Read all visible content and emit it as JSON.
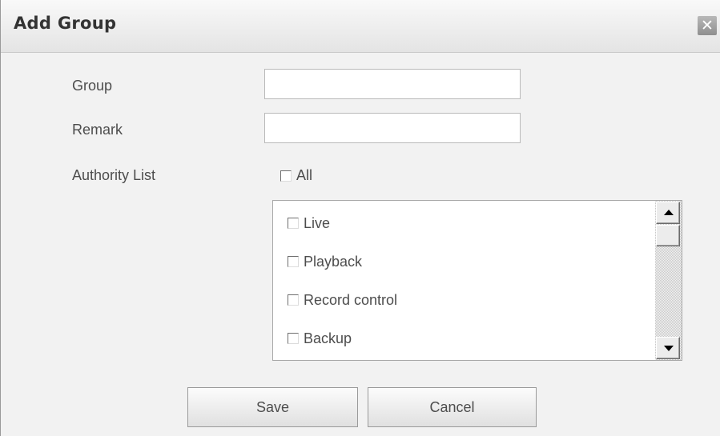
{
  "dialog": {
    "title": "Add Group",
    "close_icon": "close-icon"
  },
  "form": {
    "group_label": "Group",
    "group_value": "",
    "remark_label": "Remark",
    "remark_value": "",
    "authority_label": "Authority List",
    "all_label": "All",
    "all_checked": false
  },
  "authority_list": {
    "items": [
      {
        "label": "Live",
        "checked": false
      },
      {
        "label": "Playback",
        "checked": false
      },
      {
        "label": "Record control",
        "checked": false
      },
      {
        "label": "Backup",
        "checked": false
      }
    ]
  },
  "buttons": {
    "save_label": "Save",
    "cancel_label": "Cancel"
  }
}
